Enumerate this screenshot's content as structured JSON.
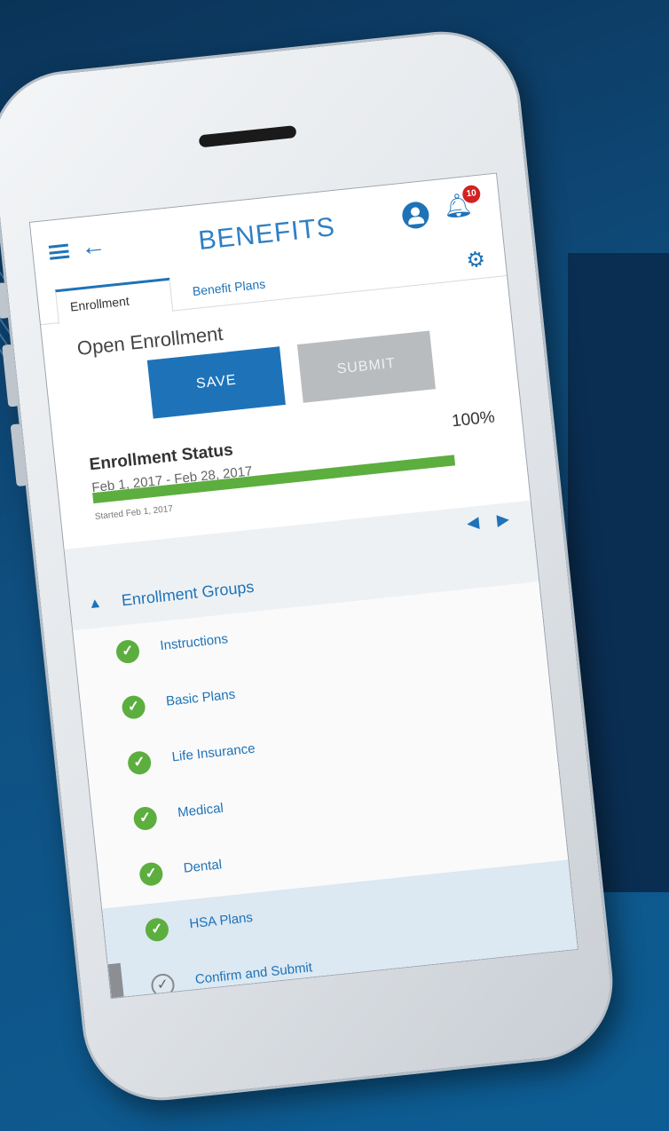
{
  "header": {
    "title": "BENEFITS",
    "notification_count": "10"
  },
  "tabs": [
    {
      "label": "Enrollment",
      "active": true
    },
    {
      "label": "Benefit Plans",
      "active": false
    }
  ],
  "open_enrollment": {
    "title": "Open Enrollment",
    "save_label": "SAVE",
    "submit_label": "SUBMIT"
  },
  "status": {
    "title": "Enrollment Status",
    "dates": "Feb 1, 2017 - Feb 28, 2017",
    "percent_label": "100%",
    "progress": 1.0,
    "started": "Started Feb 1, 2017"
  },
  "groups": {
    "title": "Enrollment Groups",
    "items": [
      {
        "label": "Instructions",
        "done": true
      },
      {
        "label": "Basic Plans",
        "done": true
      },
      {
        "label": "Life Insurance",
        "done": true
      },
      {
        "label": "Medical",
        "done": true
      },
      {
        "label": "Dental",
        "done": true
      },
      {
        "label": "HSA Plans",
        "done": true
      },
      {
        "label": "Confirm and Submit",
        "done": false
      }
    ]
  },
  "colors": {
    "accent": "#1e73b8",
    "success": "#5cae3e",
    "badge": "#d32222"
  }
}
